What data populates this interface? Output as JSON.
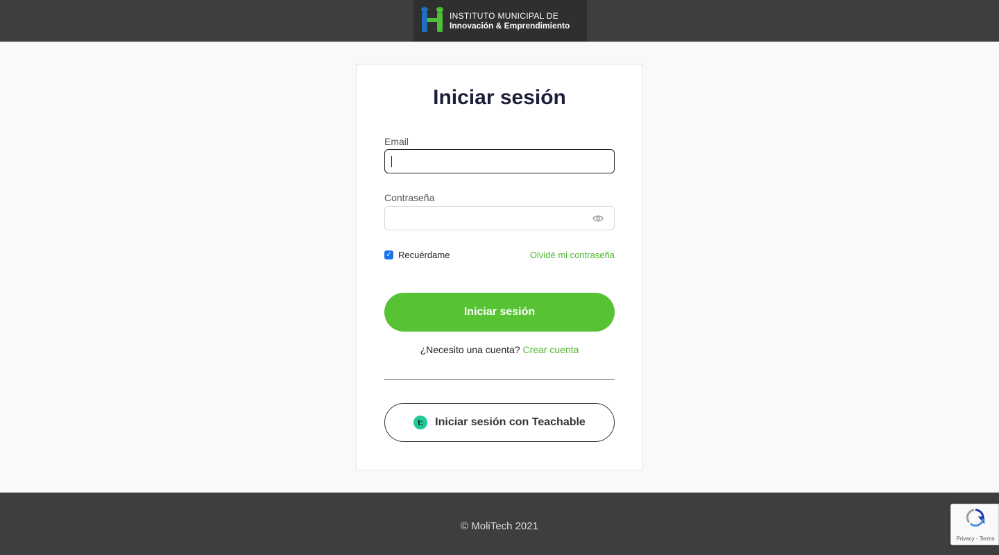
{
  "header": {
    "logo_line1": "INSTITUTO MUNICIPAL DE",
    "logo_line2": "Innovación & Emprendimiento"
  },
  "login": {
    "title": "Iniciar sesión",
    "email_label": "Email",
    "email_value": "",
    "password_label": "Contraseña",
    "password_value": "",
    "remember_label": "Recuérdame",
    "remember_checked": true,
    "forgot_link": "Olvidé mi contraseña",
    "submit_label": "Iniciar sesión",
    "signup_prompt": "¿Necesito una cuenta?",
    "signup_link": "Crear cuenta",
    "teachable_label": "Iniciar sesión con Teachable",
    "teachable_icon_text": "t:"
  },
  "footer": {
    "copyright": "© MoliTech 2021"
  },
  "recaptcha": {
    "text": "Privacy - Terms"
  },
  "colors": {
    "accent": "#57c234",
    "header_bg": "#3e3e3e",
    "checkbox": "#1a73e8",
    "teachable": "#20c997"
  },
  "icons": [
    "eye-icon",
    "checkmark-icon",
    "teachable-icon",
    "recaptcha-icon"
  ]
}
